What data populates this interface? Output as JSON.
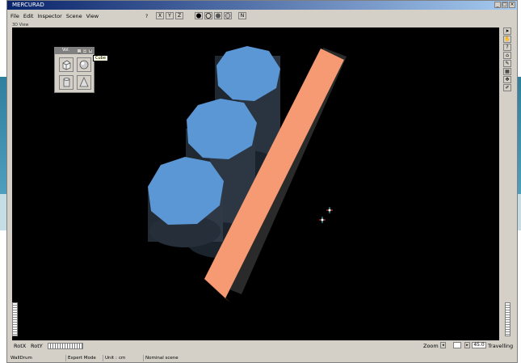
{
  "window": {
    "title": "MERCURAD",
    "min": "_",
    "max": "□",
    "close": "×"
  },
  "menu": [
    "File",
    "Edit",
    "Inspector",
    "Scene",
    "View"
  ],
  "toolbar": {
    "help": "?",
    "axes": [
      "X",
      "Y",
      "Z"
    ],
    "render_modes": [
      "solid-sphere-icon",
      "wire-sphere-icon",
      "shaded-sphere-icon",
      "flat-sphere-icon"
    ],
    "n_button": "N"
  },
  "view_label": "3D View",
  "palette": {
    "title": "Vol.",
    "tooltip": "Cube",
    "shapes": [
      "cube-icon",
      "sphere-icon",
      "cylinder-icon",
      "cone-icon"
    ]
  },
  "right_tools": [
    "pointer-icon",
    "hand-icon",
    "help-icon",
    "home-icon",
    "pencil-icon",
    "grid-icon",
    "move-icon",
    "edit-icon"
  ],
  "bottom": {
    "rotx": "RotX",
    "roty": "RotY",
    "zoom_label": "Zoom",
    "zoom_minus": "◂",
    "zoom_plus": "▸",
    "zoom_value": "45.0",
    "travelling": "Travelling"
  },
  "status": {
    "object": "WallDrum",
    "mode": "Expert Mode",
    "unit_label": "Unit :",
    "unit": "cm",
    "scene": "Nominal scene"
  },
  "colors": {
    "cylinder_top": "#5b97d4",
    "slab": "#f59a72",
    "viewport": "#000000"
  }
}
